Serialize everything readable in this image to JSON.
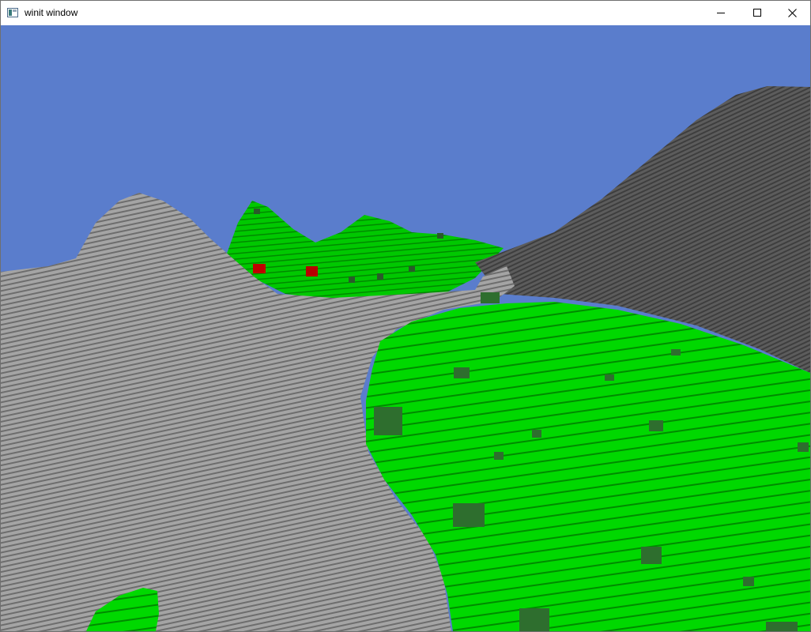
{
  "window": {
    "title": "winit window",
    "icon": "window-app-icon",
    "controls": {
      "minimize_icon": "minimize-icon",
      "maximize_icon": "maximize-icon",
      "close_icon": "close-icon"
    }
  },
  "scene": {
    "sky_color": "#5a7dcc",
    "stone_color": "#a4a4a4",
    "stone_dark_color": "#5a5a5a",
    "grass_color": "#00d800",
    "tree_color": "#2f6b2f",
    "block_color": "#c00000"
  }
}
